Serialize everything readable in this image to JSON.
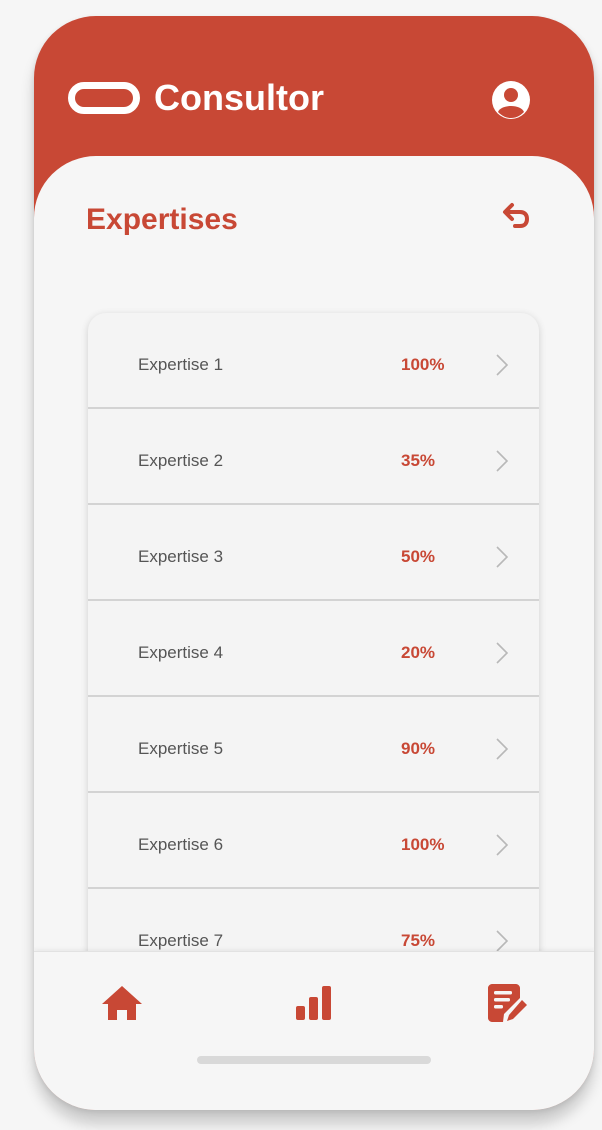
{
  "app": {
    "title": "Consultor",
    "accent_color": "#c84835",
    "logo_icon": "capsule-logo-icon",
    "profile_icon": "user-circle-icon"
  },
  "page": {
    "title": "Expertises",
    "back_icon": "undo-arrow-icon"
  },
  "expertises": [
    {
      "label": "Expertise 1",
      "percent": "100%"
    },
    {
      "label": "Expertise 2",
      "percent": "35%"
    },
    {
      "label": "Expertise 3",
      "percent": "50%"
    },
    {
      "label": "Expertise 4",
      "percent": "20%"
    },
    {
      "label": "Expertise 5",
      "percent": "90%"
    },
    {
      "label": "Expertise 6",
      "percent": "100%"
    },
    {
      "label": "Expertise 7",
      "percent": "75%"
    }
  ],
  "bottom_nav": [
    {
      "icon": "home-icon"
    },
    {
      "icon": "bar-chart-icon"
    },
    {
      "icon": "edit-document-icon"
    }
  ]
}
